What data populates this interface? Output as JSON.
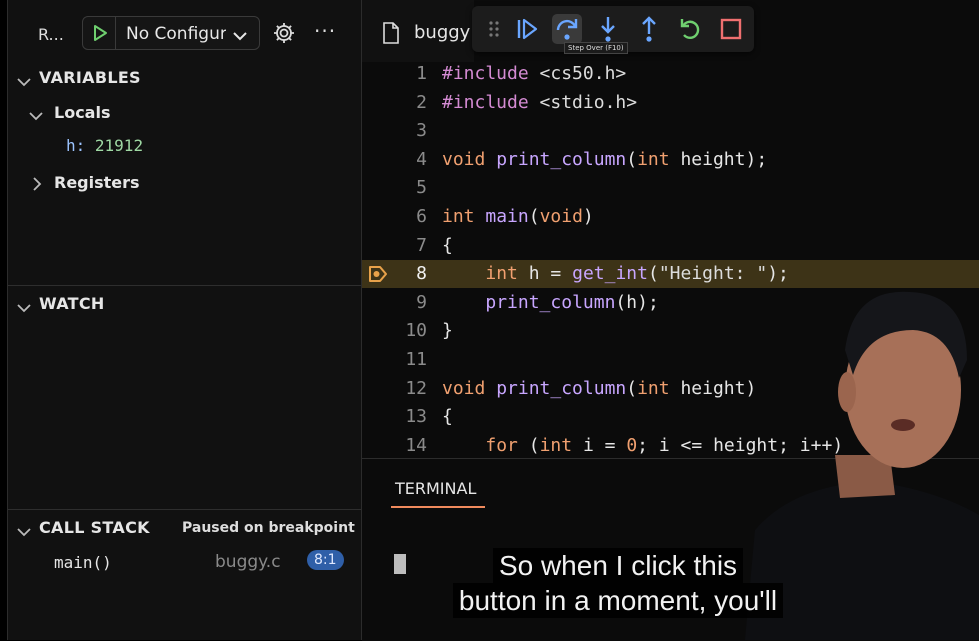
{
  "sidebar": {
    "run_title": "R...",
    "config_label": "No Configur",
    "sections": {
      "variables": "VARIABLES",
      "locals": "Locals",
      "variable_h": {
        "name": "h:",
        "value": "21912"
      },
      "registers": "Registers",
      "watch": "WATCH",
      "call_stack": "CALL STACK",
      "call_stack_status": "Paused on breakpoint"
    },
    "frame": {
      "function": "main()",
      "file": "buggy.c",
      "position": "8:1"
    }
  },
  "editor": {
    "tab_name": "buggy",
    "tooltip": "Step Over (F10)",
    "current_line": 8,
    "lines": [
      {
        "n": "1",
        "code": "#include <cs50.h>"
      },
      {
        "n": "2",
        "code": "#include <stdio.h>"
      },
      {
        "n": "3",
        "code": ""
      },
      {
        "n": "4",
        "code": "void print_column(int height);"
      },
      {
        "n": "5",
        "code": ""
      },
      {
        "n": "6",
        "code": "int main(void)"
      },
      {
        "n": "7",
        "code": "{"
      },
      {
        "n": "8",
        "code": "    int h = get_int(\"Height: \");"
      },
      {
        "n": "9",
        "code": "    print_column(h);"
      },
      {
        "n": "10",
        "code": "}"
      },
      {
        "n": "11",
        "code": ""
      },
      {
        "n": "12",
        "code": "void print_column(int height)"
      },
      {
        "n": "13",
        "code": "{"
      },
      {
        "n": "14",
        "code": "    for (int i = 0; i <= height; i++)"
      }
    ]
  },
  "terminal": {
    "tab_label": "TERMINAL"
  },
  "captions": {
    "line1": "So when I click this",
    "line2": "button in a moment, you'll"
  },
  "colors": {
    "accent": "#f08a5d",
    "breakpoint": "#e8a24a",
    "current_line_bg": "#3d3317",
    "badge": "#2f5fa8"
  },
  "icons": [
    "play-icon",
    "gear-icon",
    "more-icon",
    "drag-handle-icon",
    "continue-icon",
    "step-over-icon",
    "step-into-icon",
    "step-out-icon",
    "restart-icon",
    "stop-icon",
    "file-icon",
    "breakpoint-icon"
  ]
}
